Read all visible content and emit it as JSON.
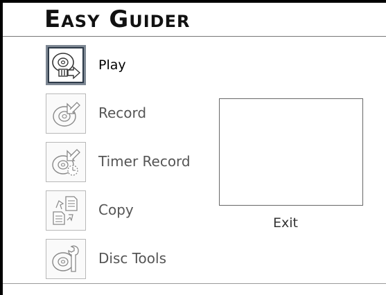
{
  "header": {
    "title_first": "E",
    "title_first_rest": "ASY",
    "title_second": "G",
    "title_second_rest": "UIDER"
  },
  "menu": [
    {
      "label": "Play",
      "icon": "disc-play-icon",
      "selected": true
    },
    {
      "label": "Record",
      "icon": "disc-record-icon",
      "selected": false
    },
    {
      "label": "Timer Record",
      "icon": "disc-timer-record-icon",
      "selected": false
    },
    {
      "label": "Copy",
      "icon": "copy-icon",
      "selected": false
    },
    {
      "label": "Disc Tools",
      "icon": "disc-tools-icon",
      "selected": false
    }
  ],
  "preview": {
    "caption": "Exit"
  },
  "colors": {
    "background": "#ffffff",
    "frame": "#000000",
    "selected_border": "#7d8793",
    "icon_stroke": "#777777"
  }
}
